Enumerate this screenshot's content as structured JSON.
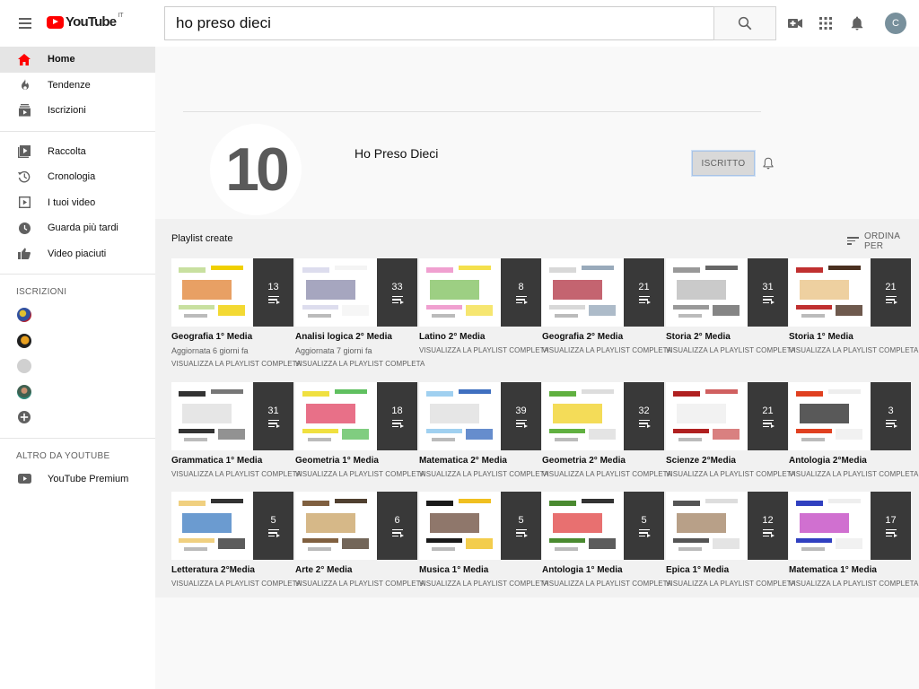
{
  "masthead": {
    "logo_text": "YouTube",
    "logo_country": "IT",
    "search_value": "ho preso dieci",
    "avatar_letter": "C"
  },
  "sidebar": {
    "main": [
      {
        "label": "Home",
        "icon": "home-icon"
      },
      {
        "label": "Tendenze",
        "icon": "trending-icon"
      },
      {
        "label": "Iscrizioni",
        "icon": "subscriptions-icon"
      }
    ],
    "library": [
      {
        "label": "Raccolta",
        "icon": "library-icon"
      },
      {
        "label": "Cronologia",
        "icon": "history-icon"
      },
      {
        "label": "I tuoi video",
        "icon": "your-videos-icon"
      },
      {
        "label": "Guarda più tardi",
        "icon": "watch-later-icon"
      },
      {
        "label": "Video piaciuti",
        "icon": "liked-icon"
      }
    ],
    "subscriptions_title": "ISCRIZIONI",
    "more_title": "ALTRO DA YOUTUBE",
    "more": [
      {
        "label": "YouTube Premium",
        "icon": "youtube-premium-icon"
      }
    ]
  },
  "channel": {
    "avatar_text": "10",
    "name": "Ho Preso Dieci",
    "subscribe_label": "ISCRITTO"
  },
  "shelf": {
    "title": "Playlist create",
    "sort_label": "ORDINA PER",
    "link_label": "VISUALIZZA LA PLAYLIST COMPLETA",
    "rows": [
      [
        {
          "title": "Geografia 1° Media",
          "count": "13",
          "meta": "Aggiornata 6 giorni fa"
        },
        {
          "title": "Analisi logica 2° Media",
          "count": "33",
          "meta": "Aggiornata 7 giorni fa"
        },
        {
          "title": "Latino 2° Media",
          "count": "8"
        },
        {
          "title": "Geografia 2° Media",
          "count": "21"
        },
        {
          "title": "Storia 2° Media",
          "count": "31"
        },
        {
          "title": "Storia 1° Media",
          "count": "21"
        }
      ],
      [
        {
          "title": "Grammatica 1° Media",
          "count": "31"
        },
        {
          "title": "Geometria 1° Media",
          "count": "18"
        },
        {
          "title": "Matematica 2° Media",
          "count": "39"
        },
        {
          "title": "Geometria 2° Media",
          "count": "32"
        },
        {
          "title": "Scienze 2°Media",
          "count": "21"
        },
        {
          "title": "Antologia 2°Media",
          "count": "3"
        }
      ],
      [
        {
          "title": "Letteratura 2°Media",
          "count": "5"
        },
        {
          "title": "Arte 2° Media",
          "count": "6"
        },
        {
          "title": "Musica 1° Media",
          "count": "5"
        },
        {
          "title": "Antologia 1° Media",
          "count": "5"
        },
        {
          "title": "Epica 1° Media",
          "count": "12"
        },
        {
          "title": "Matematica 1° Media",
          "count": "17"
        }
      ]
    ]
  },
  "colors": {
    "brand_red": "#ff0000",
    "overlay": "#282828",
    "active_nav": "#e5e5e5"
  }
}
